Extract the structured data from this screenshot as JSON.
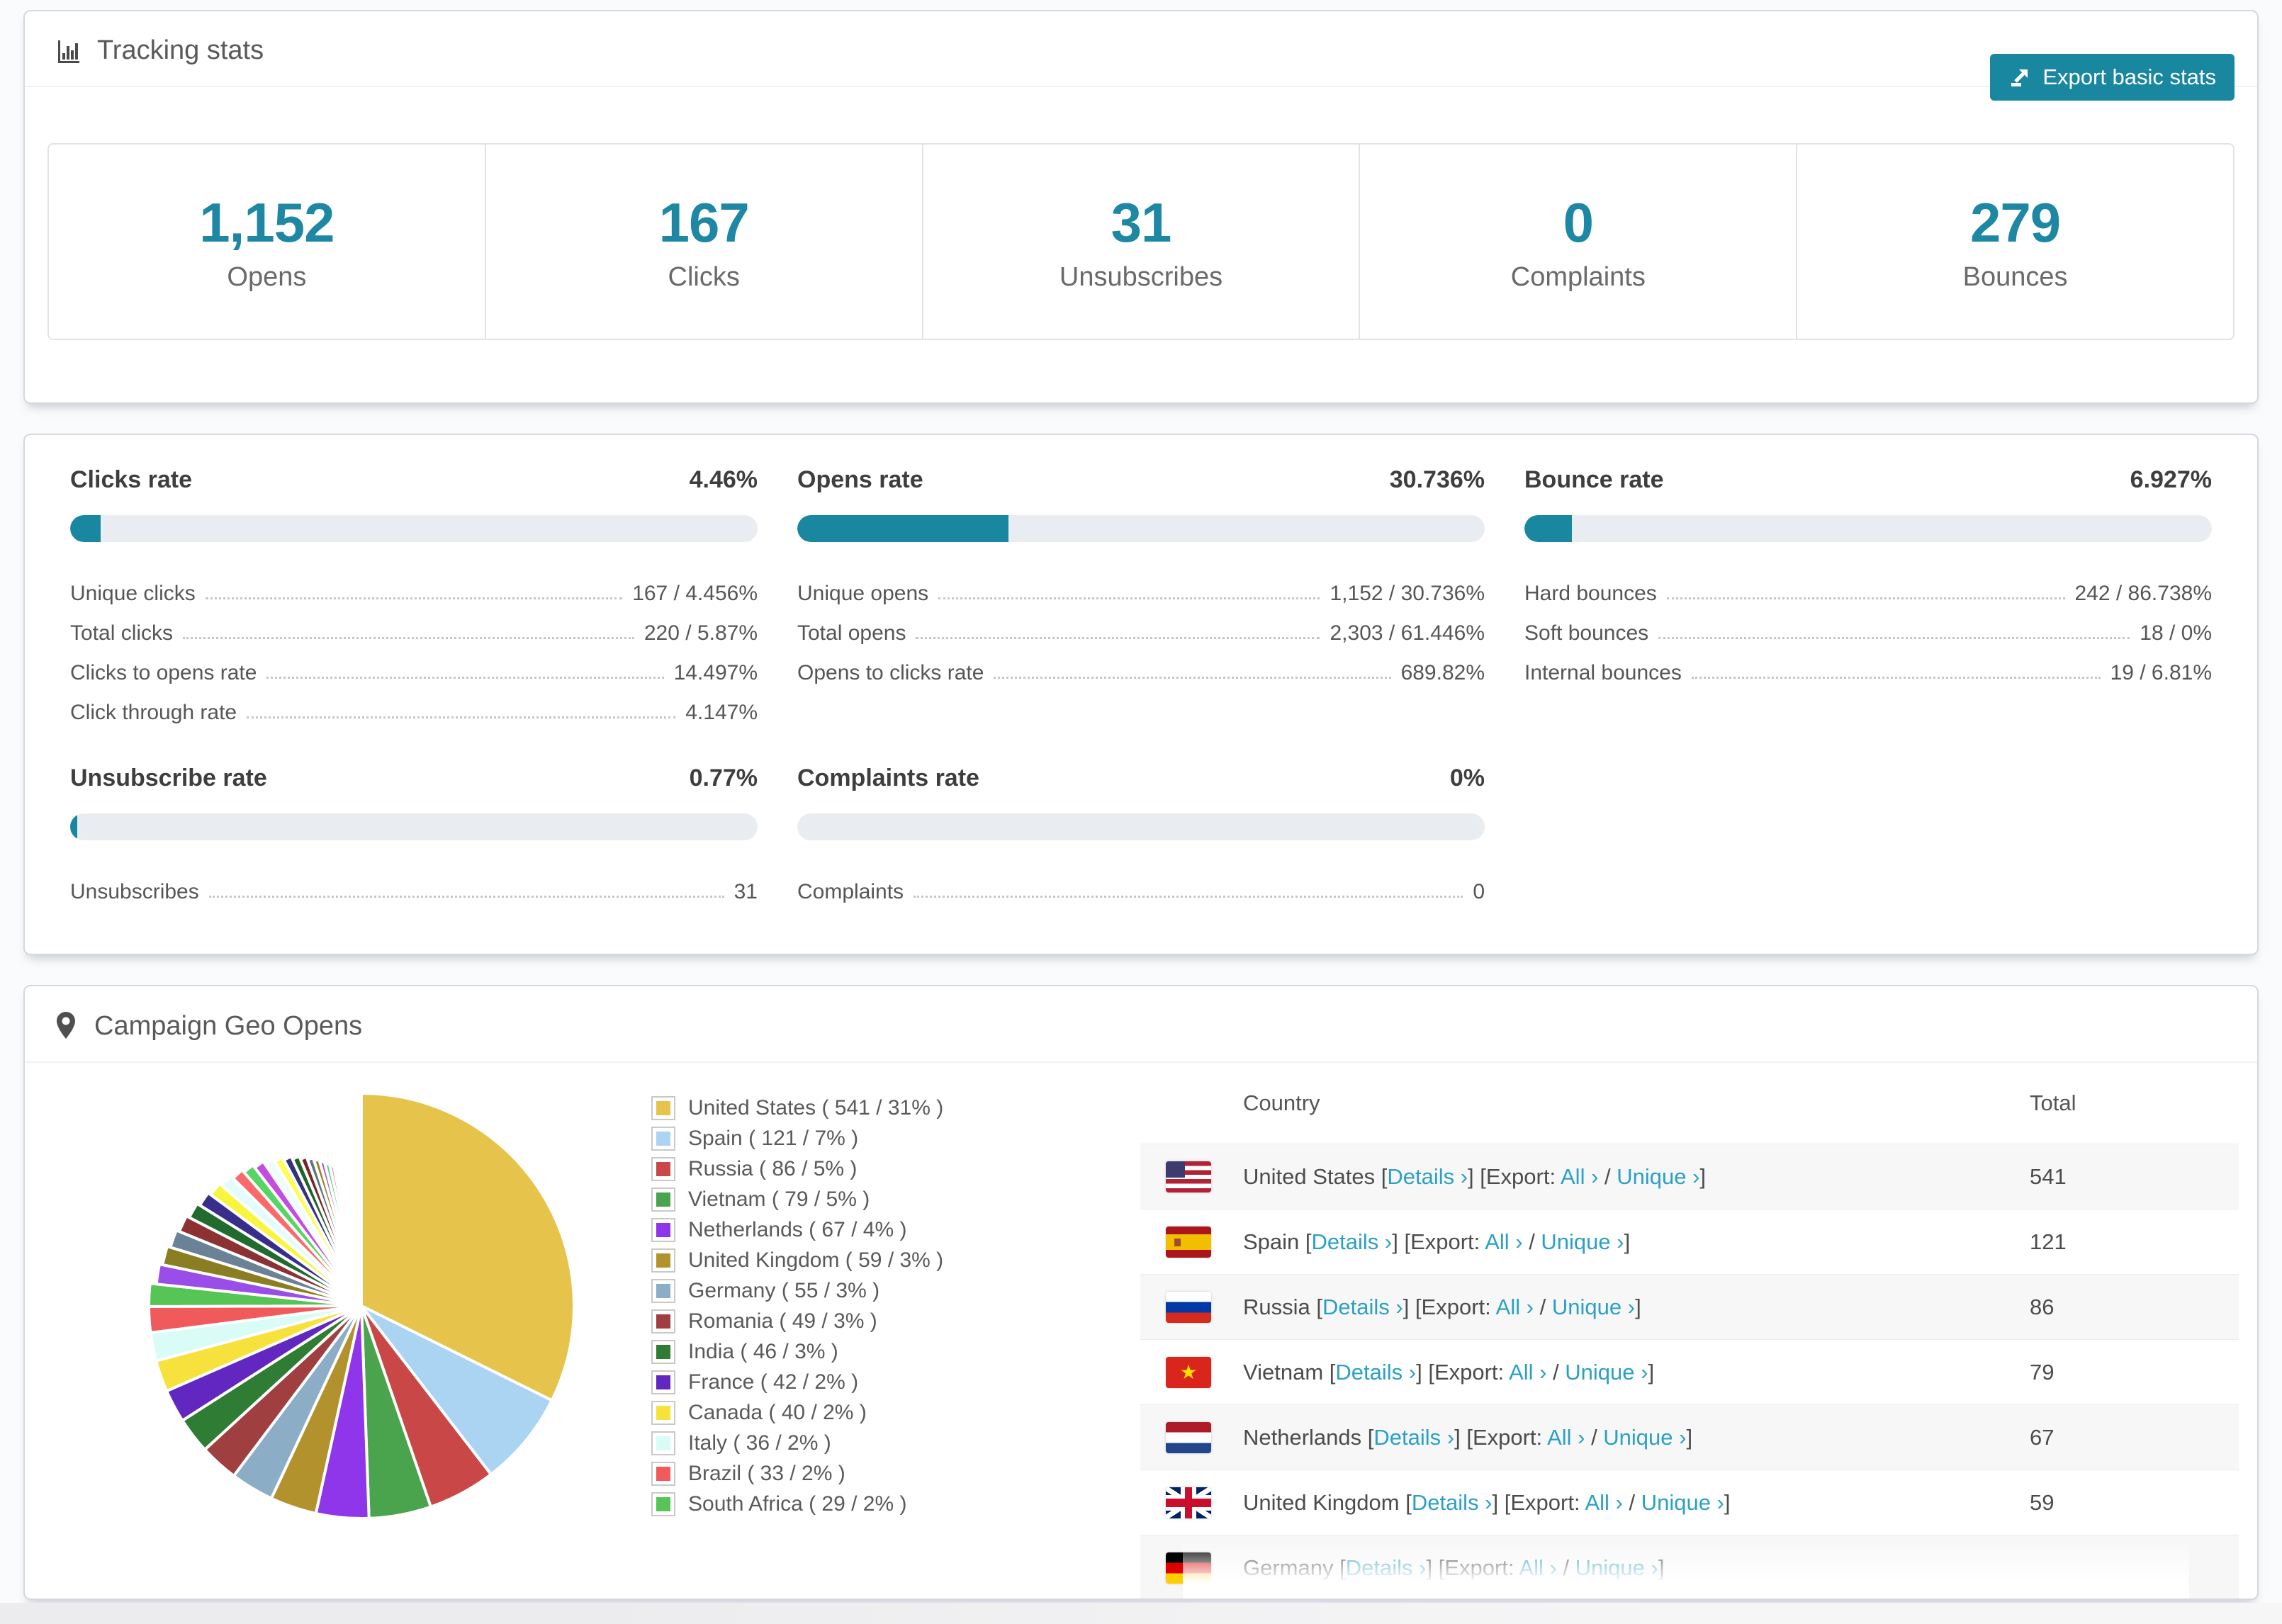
{
  "accent": "#1a87a1",
  "link_color": "#2ba0c4",
  "tracking": {
    "title": "Tracking stats",
    "export_button": "Export basic stats",
    "stats": [
      {
        "value": "1,152",
        "label": "Opens"
      },
      {
        "value": "167",
        "label": "Clicks"
      },
      {
        "value": "31",
        "label": "Unsubscribes"
      },
      {
        "value": "0",
        "label": "Complaints"
      },
      {
        "value": "279",
        "label": "Bounces"
      }
    ]
  },
  "rates": {
    "blocks": [
      {
        "title": "Clicks rate",
        "value": "4.46%",
        "bar_pct": 4.46,
        "rows": [
          [
            "Unique clicks",
            "167 / 4.456%"
          ],
          [
            "Total clicks",
            "220 / 5.87%"
          ],
          [
            "Clicks to opens rate",
            "14.497%"
          ],
          [
            "Click through rate",
            "4.147%"
          ]
        ]
      },
      {
        "title": "Opens rate",
        "value": "30.736%",
        "bar_pct": 30.736,
        "rows": [
          [
            "Unique opens",
            "1,152 / 30.736%"
          ],
          [
            "Total opens",
            "2,303 / 61.446%"
          ],
          [
            "Opens to clicks rate",
            "689.82%"
          ]
        ]
      },
      {
        "title": "Bounce rate",
        "value": "6.927%",
        "bar_pct": 6.927,
        "rows": [
          [
            "Hard bounces",
            "242 / 86.738%"
          ],
          [
            "Soft bounces",
            "18 / 0%"
          ],
          [
            "Internal bounces",
            "19 / 6.81%"
          ]
        ]
      },
      {
        "title": "Unsubscribe rate",
        "value": "0.77%",
        "bar_pct": 0.77,
        "rows": [
          [
            "Unsubscribes",
            "31"
          ]
        ]
      },
      {
        "title": "Complaints rate",
        "value": "0%",
        "bar_pct": 0,
        "rows": [
          [
            "Complaints",
            "0"
          ]
        ]
      }
    ]
  },
  "geo": {
    "title": "Campaign Geo Opens",
    "table": {
      "headers": [
        "Country",
        "Total"
      ],
      "link_labels": {
        "open": "[",
        "details": "Details ›",
        "mid": "] [Export: ",
        "all": "All ›",
        "sep": " / ",
        "unique": "Unique ›",
        "close": "]"
      },
      "rows": [
        {
          "country": "United States",
          "flag": "us",
          "total": "541"
        },
        {
          "country": "Spain",
          "flag": "es",
          "total": "121"
        },
        {
          "country": "Russia",
          "flag": "ru",
          "total": "86"
        },
        {
          "country": "Vietnam",
          "flag": "vn",
          "total": "79"
        },
        {
          "country": "Netherlands",
          "flag": "nl",
          "total": "67"
        },
        {
          "country": "United Kingdom",
          "flag": "gb",
          "total": "59"
        },
        {
          "country": "Germany",
          "flag": "de",
          "total": ""
        }
      ]
    }
  },
  "chart_data": {
    "type": "pie",
    "title": "Campaign Geo Opens",
    "legend_position": "right",
    "start_angle_deg": -90,
    "slices": [
      {
        "label": "United States",
        "value": 541,
        "pct": 31,
        "color": "#e6c34a"
      },
      {
        "label": "Spain",
        "value": 121,
        "pct": 7,
        "color": "#abd3f2"
      },
      {
        "label": "Russia",
        "value": 86,
        "pct": 5,
        "color": "#c94747"
      },
      {
        "label": "Vietnam",
        "value": 79,
        "pct": 5,
        "color": "#4aa34d"
      },
      {
        "label": "Netherlands",
        "value": 67,
        "pct": 4,
        "color": "#8f35ea"
      },
      {
        "label": "United Kingdom",
        "value": 59,
        "pct": 3,
        "color": "#b2922d"
      },
      {
        "label": "Germany",
        "value": 55,
        "pct": 3,
        "color": "#8cadc6"
      },
      {
        "label": "Romania",
        "value": 49,
        "pct": 3,
        "color": "#a03f3f"
      },
      {
        "label": "India",
        "value": 46,
        "pct": 3,
        "color": "#2f7d35"
      },
      {
        "label": "France",
        "value": 42,
        "pct": 2,
        "color": "#6127c0"
      },
      {
        "label": "Canada",
        "value": 40,
        "pct": 2,
        "color": "#f7e13c"
      },
      {
        "label": "Italy",
        "value": 36,
        "pct": 2,
        "color": "#d9fcf7"
      },
      {
        "label": "Brazil",
        "value": 33,
        "pct": 2,
        "color": "#f15a5a"
      },
      {
        "label": "South Africa",
        "value": 29,
        "pct": 2,
        "color": "#56c556"
      }
    ],
    "others": {
      "values": [
        26,
        25,
        24,
        23,
        22,
        21,
        20,
        19,
        18,
        17,
        16,
        15,
        14,
        13,
        12,
        11,
        10,
        9,
        8,
        8,
        7,
        7,
        6,
        6,
        5,
        5,
        4,
        4,
        3,
        3,
        2,
        2,
        2,
        1,
        1,
        1
      ],
      "colors": [
        "#9b4dea",
        "#8a7d22",
        "#6b8296",
        "#8c3232",
        "#226b2e",
        "#3a2e8c",
        "#f7f53e",
        "#e4fcff",
        "#fa6a6a",
        "#57d463",
        "#c44de0",
        "#eefcff",
        "#fdfd55",
        "#32327e",
        "#1f612c",
        "#7c2424",
        "#5d7687",
        "#948722",
        "#bb4fe6",
        "#52e070",
        "#ff70d0",
        "#f2fdff",
        "#ffff66",
        "#d94fe2",
        "#57e057",
        "#e05252",
        "#d1a21c",
        "#aad4f5",
        "#e25555",
        "#3f9f46",
        "#9440ec",
        "#c9a02a",
        "#a8d2f2",
        "#cc4a4a",
        "#4aa64e",
        "#8f35ea"
      ]
    }
  }
}
